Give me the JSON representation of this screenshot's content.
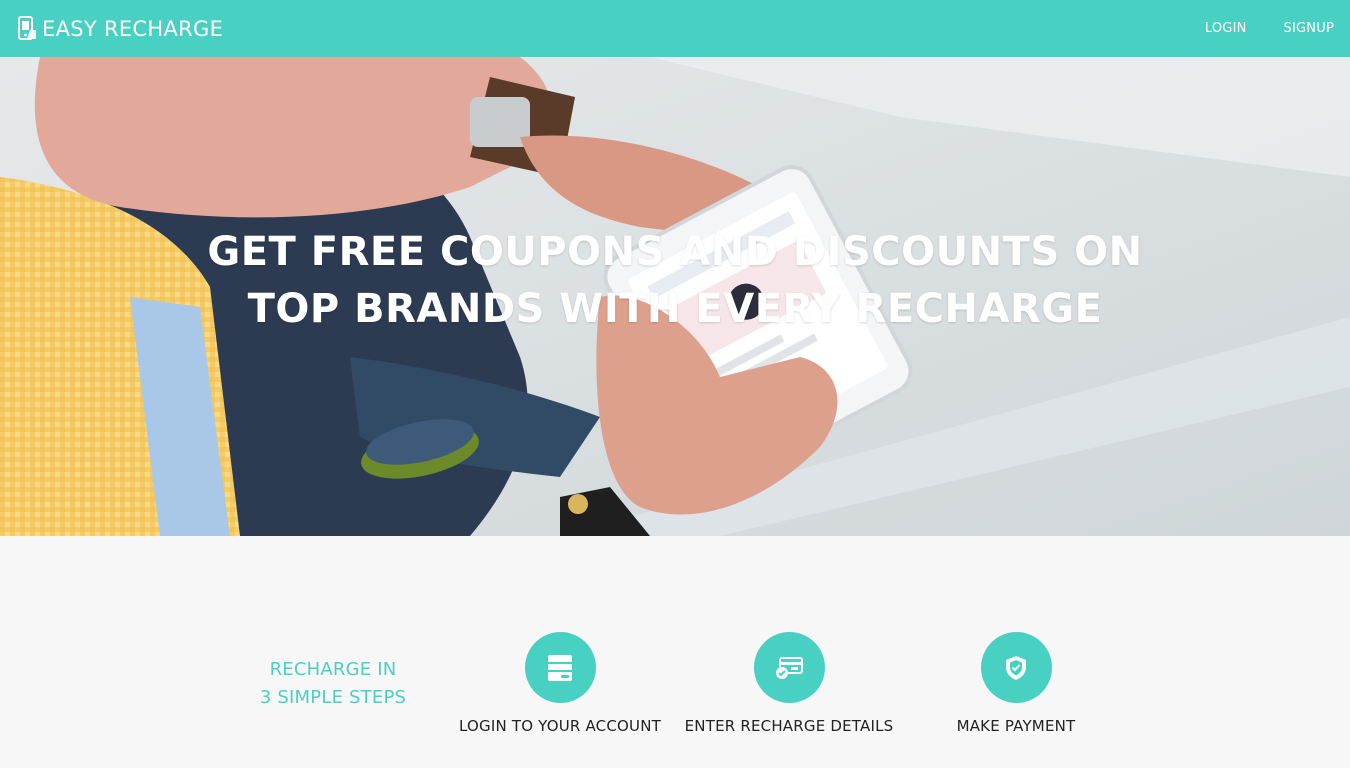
{
  "navbar": {
    "brand": "EASY RECHARGE",
    "brand_icon": "phone-recharge-icon",
    "links": [
      {
        "label": "LOGIN"
      },
      {
        "label": "SIGNUP"
      }
    ],
    "color": "#48d0c3"
  },
  "hero": {
    "title_line1": "GET FREE COUPONS AND DISCOUNTS ON",
    "title_line2": "TOP BRANDS WITH EVERY RECHARGE"
  },
  "steps": {
    "heading_line1": "RECHARGE IN",
    "heading_line2": "3 SIMPLE STEPS",
    "items": [
      {
        "icon": "account-card-icon",
        "label": "LOGIN TO YOUR ACCOUNT"
      },
      {
        "icon": "credit-card-check-icon",
        "label": "ENTER RECHARGE DETAILS"
      },
      {
        "icon": "shield-check-icon",
        "label": "MAKE PAYMENT"
      }
    ],
    "accent": "#48d0c3"
  }
}
